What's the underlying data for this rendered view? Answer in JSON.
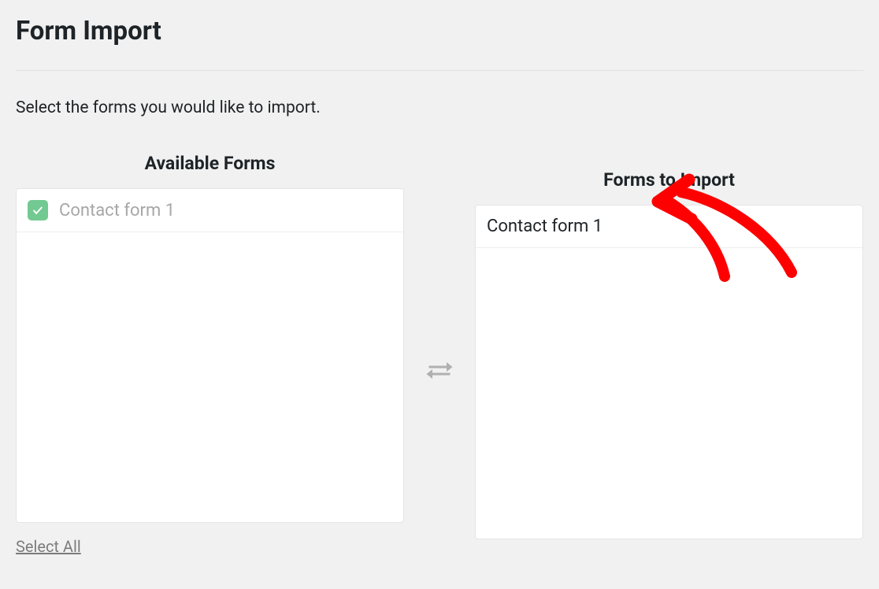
{
  "page": {
    "title": "Form Import",
    "instruction": "Select the forms you would like to import."
  },
  "available": {
    "header": "Available Forms",
    "items": [
      {
        "label": "Contact form 1",
        "checked": true
      }
    ],
    "selectAllLabel": "Select All"
  },
  "import": {
    "header": "Forms to Import",
    "items": [
      {
        "label": "Contact form 1"
      }
    ]
  }
}
